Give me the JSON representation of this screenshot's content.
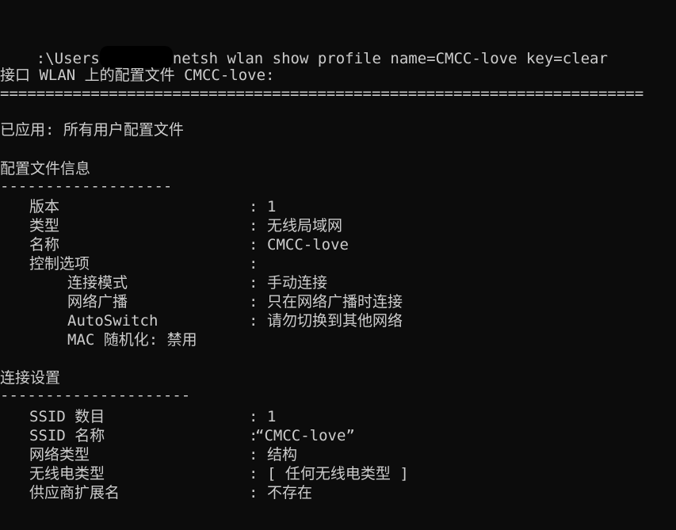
{
  "command": {
    "prompt_prefix": ":\\Users",
    "prompt_rest": "netsh wlan show profile name=CMCC-love key=clear"
  },
  "header": "接口 WLAN 上的配置文件 CMCC-love:",
  "separator": "=======================================================================",
  "applied": "已应用: 所有用户配置文件",
  "profile_info": {
    "title": "配置文件信息",
    "underline": "-------------------",
    "rows": [
      {
        "key": "版本",
        "colon": ":",
        "value": "1"
      },
      {
        "key": "类型",
        "colon": ":",
        "value": "无线局域网"
      },
      {
        "key": "名称",
        "colon": ":",
        "value": "CMCC-love"
      },
      {
        "key": "控制选项",
        "colon": ":",
        "value": ""
      },
      {
        "key": "连接模式",
        "colon": ":",
        "value": "手动连接"
      },
      {
        "key": "网络广播",
        "colon": ":",
        "value": "只在网络广播时连接"
      },
      {
        "key": "AutoSwitch",
        "colon": ":",
        "value": "请勿切换到其他网络"
      },
      {
        "key": "MAC 随机化: 禁用",
        "colon": "",
        "value": ""
      }
    ]
  },
  "connection": {
    "title": "连接设置",
    "underline": "---------------------",
    "rows": [
      {
        "key": "SSID 数目",
        "colon": ":",
        "value": "1"
      },
      {
        "key": "SSID 名称",
        "colon": ":",
        "value": "“CMCC-love”"
      },
      {
        "key": "网络类型",
        "colon": ":",
        "value": "结构"
      },
      {
        "key": "无线电类型",
        "colon": ":",
        "value": "[ 任何无线电类型 ]"
      },
      {
        "key": "供应商扩展名",
        "colon": ":",
        "value": "不存在"
      }
    ]
  }
}
